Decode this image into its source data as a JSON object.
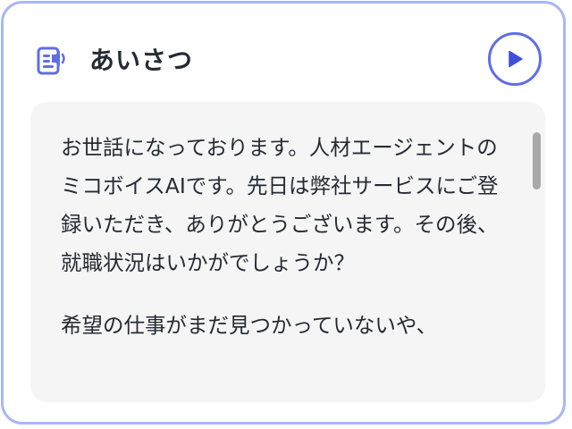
{
  "card": {
    "title": "あいさつ",
    "icons": {
      "header": "speaker-document-icon",
      "play": "play-icon"
    },
    "message": {
      "paragraphs": [
        "お世話になっております。人材エージェントのミコボイスAIです。先日は弊社サービスにご登録いただき、ありがとうございます。その後、就職状況はいかがでしょうか？",
        "希望の仕事がまだ見つかっていないや、"
      ]
    }
  },
  "colors": {
    "accent": "#5f6ee6",
    "card_border": "#a9b7f6",
    "panel_background": "#f5f5f5",
    "text": "#262a33",
    "scrollbar": "#a9a9a9"
  }
}
